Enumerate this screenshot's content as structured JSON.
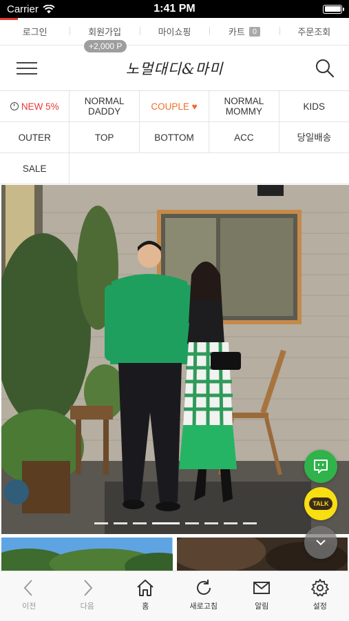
{
  "status_bar": {
    "carrier": "Carrier",
    "time": "1:41 PM"
  },
  "top_links": {
    "login": "로그인",
    "signup": "회원가입",
    "signup_point": "+2,000 P",
    "myshop": "마이쇼핑",
    "cart": "카트",
    "cart_count": "0",
    "order_lookup": "주문조회"
  },
  "header": {
    "logo": "노멀대디&마미"
  },
  "categories": [
    {
      "label": "NEW 5%"
    },
    {
      "label": "NORMAL DADDY"
    },
    {
      "label": "COUPLE ♥"
    },
    {
      "label": "NORMAL MOMMY"
    },
    {
      "label": "KIDS"
    },
    {
      "label": "OUTER"
    },
    {
      "label": "TOP"
    },
    {
      "label": "BOTTOM"
    },
    {
      "label": "ACC"
    },
    {
      "label": "당일배송"
    },
    {
      "label": "SALE"
    }
  ],
  "slider": {
    "slide_count": 8,
    "active_index": 3
  },
  "floating": {
    "talk": "TALK"
  },
  "bottom_bar": {
    "back": "이전",
    "forward": "다음",
    "home": "홈",
    "refresh": "새로고침",
    "notice": "알림",
    "settings": "설정"
  },
  "colors": {
    "accent_red": "#e53935",
    "couple_orange": "#f26b2a",
    "chat_green": "#2fb34a",
    "kakao_yellow": "#f7df12"
  }
}
